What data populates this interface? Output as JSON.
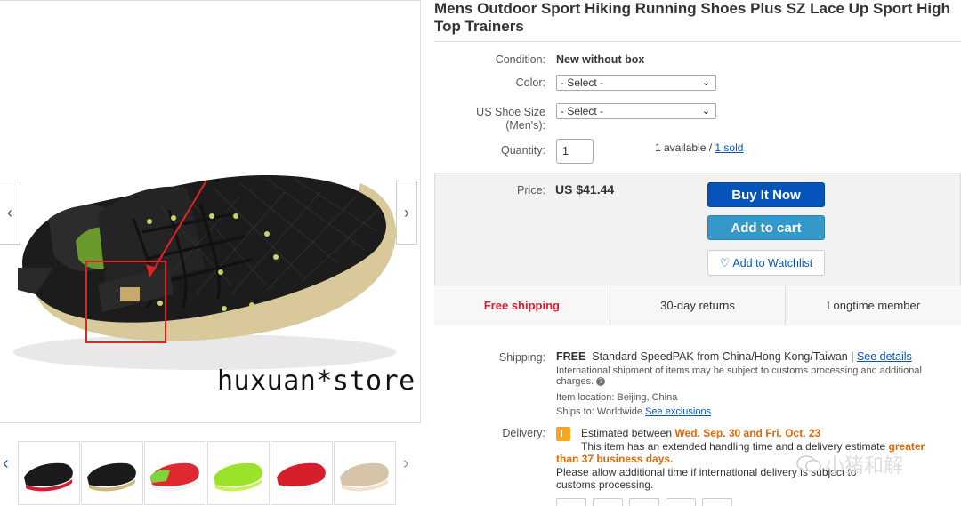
{
  "listing": {
    "title": "Mens Outdoor Sport Hiking Running Shoes Plus SZ Lace Up Sport High Top Trainers"
  },
  "image": {
    "watermark": "huxuan*store",
    "prev_arrow": "‹",
    "next_arrow": "›"
  },
  "thumbnails": {
    "prev_arrow": "‹",
    "next_arrow": "›",
    "items": [
      {
        "name": "black-red shoe"
      },
      {
        "name": "black-gold shoe"
      },
      {
        "name": "green-red shoe"
      },
      {
        "name": "neon green shoe"
      },
      {
        "name": "red shoe"
      },
      {
        "name": "beige shoe"
      }
    ]
  },
  "details": {
    "condition_label": "Condition:",
    "condition_value": "New without box",
    "color_label": "Color:",
    "color_select": "- Select -",
    "size_label_1": "US Shoe Size",
    "size_label_2": "(Men's):",
    "size_select": "- Select -",
    "quantity_label": "Quantity:",
    "quantity_value": "1",
    "available_text": "1 available / ",
    "sold_link": "1 sold"
  },
  "buybox": {
    "price_label": "Price:",
    "price_value": "US $41.44",
    "buy_now": "Buy It Now",
    "add_to_cart": "Add to cart",
    "watchlist": "Add to Watchlist",
    "free_shipping": "Free shipping",
    "returns": "30-day returns",
    "member": "Longtime member"
  },
  "shipping": {
    "label": "Shipping:",
    "free": "FREE",
    "method": "Standard SpeedPAK from China/Hong Kong/Taiwan | ",
    "details_link": "See details",
    "note_1": "International shipment of items may be subject to customs processing and additional",
    "note_2": "charges.",
    "help_icon": "?",
    "location": "Item location:  Beijing, China",
    "ships_to": "Ships to:  Worldwide  ",
    "exclusions_link": "See exclusions"
  },
  "delivery": {
    "label": "Delivery:",
    "line1_prefix": "Estimated between ",
    "line1_dates": "Wed. Sep. 30 and Fri. Oct. 23",
    "line2_text": "This item has an extended handling time and a delivery estimate ",
    "line2_highlight": "greater",
    "line3_highlight": "than 37 business days.",
    "line4": "Please allow additional time if international delivery is subject to",
    "line5": "customs processing."
  },
  "overlay_watermark": "小猪和解",
  "colors": {
    "buy_now_bg": "#0654ba",
    "add_cart_bg": "#3498ca",
    "free_shipping": "#dd1e31",
    "link": "#0654ba",
    "delivery_highlight": "#dd6a0a",
    "annotation_red": "#e02424"
  }
}
